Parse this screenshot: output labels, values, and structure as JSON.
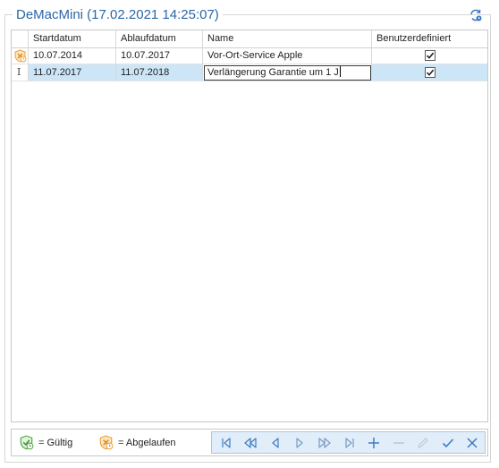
{
  "group": {
    "title": "DeMacMini (17.02.2021 14:25:07)"
  },
  "refresh": {
    "icon": "refresh-icon"
  },
  "grid": {
    "columns": [
      "Startdatum",
      "Ablaufdatum",
      "Name",
      "Benutzerdefiniert"
    ],
    "rows": [
      {
        "status_icon": "expired-shield-icon",
        "start": "10.07.2014",
        "end": "10.07.2017",
        "name": "Vor-Ort-Service Apple",
        "custom": true,
        "selected": false
      },
      {
        "status_icon": "text-cursor-icon",
        "start": "11.07.2017",
        "end": "11.07.2018",
        "name": "Verlängerung Garantie um 1 J",
        "custom": true,
        "selected": true,
        "editing": true
      }
    ]
  },
  "legend": {
    "valid_label": "= Gültig",
    "expired_label": "= Abgelaufen"
  },
  "navigator": {
    "buttons": [
      "first-icon",
      "prev-page-icon",
      "prev-icon",
      "next-icon",
      "next-page-icon",
      "last-icon",
      "append-icon",
      "delete-icon",
      "edit-icon",
      "end-edit-icon",
      "cancel-edit-icon"
    ]
  },
  "colors": {
    "accent": "#2b67a8",
    "selection": "#cde6f7",
    "nav_icon": "#3c7cc4",
    "expired": "#e8a23c",
    "valid": "#4caa3c"
  }
}
